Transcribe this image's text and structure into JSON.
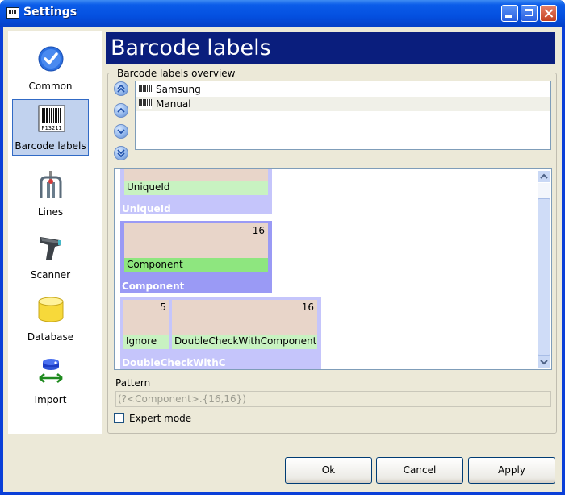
{
  "window": {
    "title": "Settings"
  },
  "nav": {
    "items": [
      {
        "label": "Common",
        "icon": "check-circle-icon"
      },
      {
        "label": "Barcode labels",
        "icon": "barcode-icon",
        "active": true,
        "icon_text": "P13211"
      },
      {
        "label": "Lines",
        "icon": "lines-icon"
      },
      {
        "label": "Scanner",
        "icon": "scanner-icon"
      },
      {
        "label": "Database",
        "icon": "database-icon"
      },
      {
        "label": "Import",
        "icon": "import-icon"
      }
    ]
  },
  "header": {
    "title": "Barcode labels"
  },
  "overview": {
    "label": "Barcode labels overview",
    "items": [
      {
        "label": "Samsung"
      },
      {
        "label": "Manual"
      }
    ]
  },
  "segments": {
    "uniqueid": {
      "group_label": "UniqueId",
      "cell_label": "UniqueId"
    },
    "component": {
      "group_label": "Component",
      "cell_label": "Component",
      "length": "16"
    },
    "doublecheck": {
      "group_label": "DoubleCheckWithC",
      "cells": [
        {
          "label": "Ignore",
          "length": "5"
        },
        {
          "label": "DoubleCheckWithComponent",
          "length": "16"
        }
      ]
    }
  },
  "pattern": {
    "label": "Pattern",
    "value": "(?<Component>.{16,16})"
  },
  "expert_mode": {
    "label": "Expert mode",
    "checked": false
  },
  "buttons": {
    "ok": "Ok",
    "cancel": "Cancel",
    "apply": "Apply"
  },
  "colors": {
    "title_bar": "#0450e0",
    "header_bg": "#0a1e7d",
    "segment_bg": "#9a9af5",
    "cell_top": "#e8d5c9",
    "cell_bottom": "#c8f2c1"
  }
}
